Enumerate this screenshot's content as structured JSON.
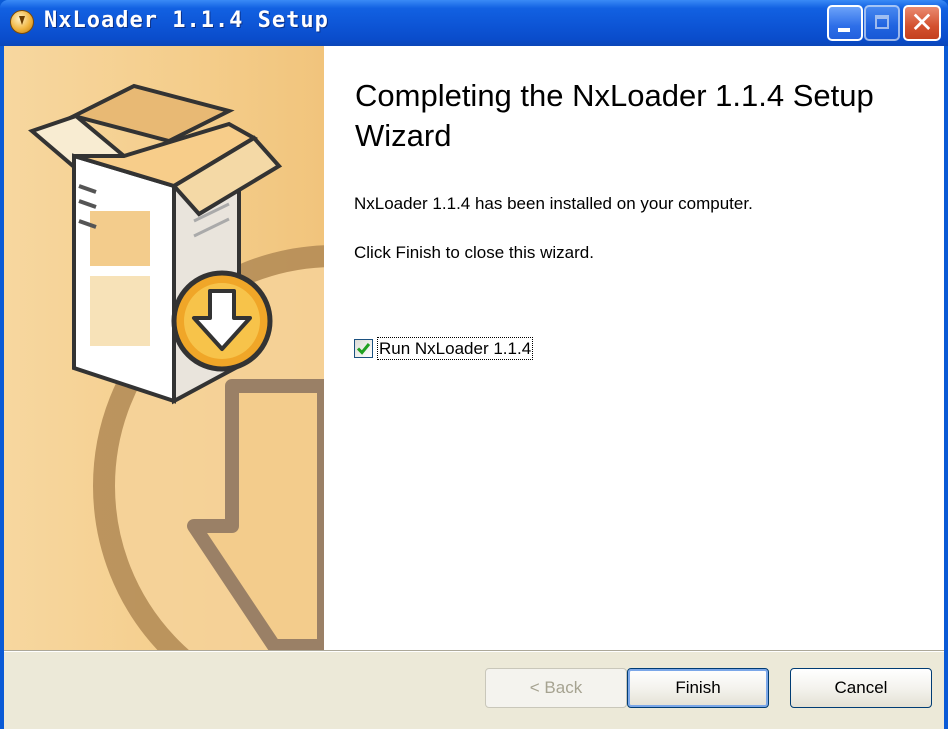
{
  "window": {
    "title": "NxLoader 1.1.4 Setup"
  },
  "main": {
    "heading": "Completing the NxLoader 1.1.4 Setup Wizard",
    "installed_text": "NxLoader 1.1.4 has been installed on your computer.",
    "finish_hint": "Click Finish to close this wizard.",
    "run_checkbox": {
      "label": "Run NxLoader 1.1.4",
      "checked": true
    }
  },
  "buttons": {
    "back": "< Back",
    "finish": "Finish",
    "cancel": "Cancel"
  },
  "icons": {
    "app": "installer-icon",
    "banner": "box-download-icon"
  },
  "colors": {
    "titlebar": "#0a54d4",
    "banner": "#f4cd8b",
    "face": "#ece9d8",
    "check": "#21a121"
  }
}
